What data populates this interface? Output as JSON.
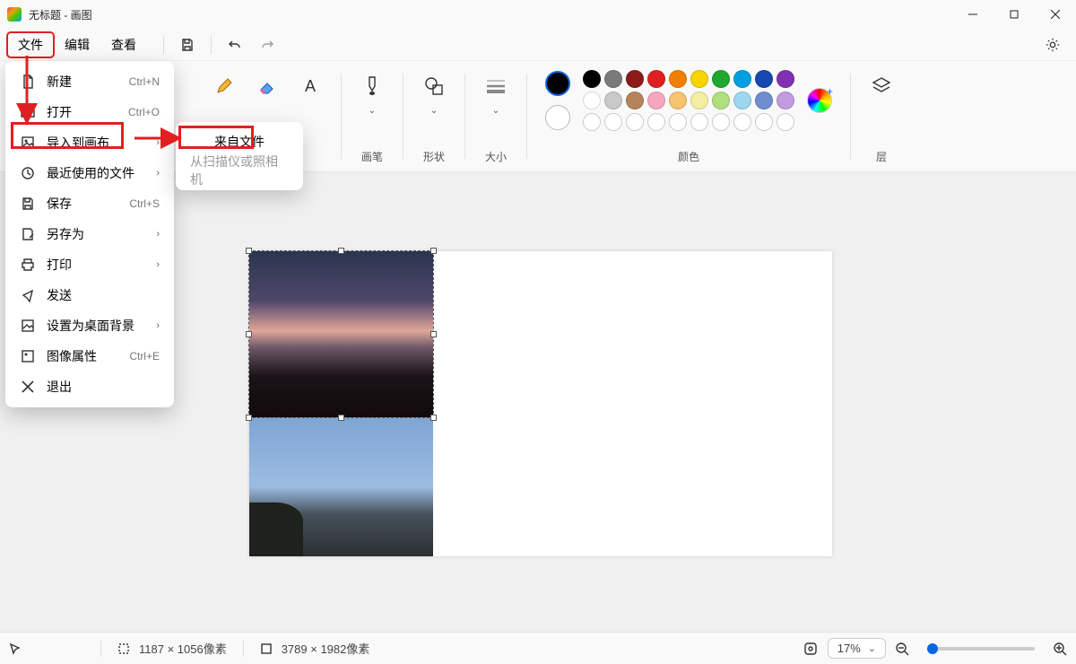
{
  "window": {
    "title": "无标题 - 画图"
  },
  "menubar": {
    "file": "文件",
    "edit": "编辑",
    "view": "查看"
  },
  "ribbon": {
    "brush_group": "画笔",
    "shape_group": "形状",
    "size_group": "大小",
    "color_group": "颜色",
    "layer_group": "层"
  },
  "file_menu": {
    "new": {
      "label": "新建",
      "shortcut": "Ctrl+N"
    },
    "open": {
      "label": "打开",
      "shortcut": "Ctrl+O"
    },
    "import": {
      "label": "导入到画布"
    },
    "recent": {
      "label": "最近使用的文件"
    },
    "save": {
      "label": "保存",
      "shortcut": "Ctrl+S"
    },
    "saveas": {
      "label": "另存为"
    },
    "print": {
      "label": "打印"
    },
    "send": {
      "label": "发送"
    },
    "setbg": {
      "label": "设置为桌面背景"
    },
    "props": {
      "label": "图像属性",
      "shortcut": "Ctrl+E"
    },
    "exit": {
      "label": "退出"
    }
  },
  "submenu": {
    "from_file": "来自文件",
    "from_scanner": "从扫描仪或照相机"
  },
  "palette": {
    "row1": [
      "#000000",
      "#7a7a7a",
      "#8c1a1a",
      "#e02020",
      "#f08000",
      "#f5d400",
      "#1fa82e",
      "#00a0e0",
      "#1648b0",
      "#8030b0"
    ],
    "row2": [
      "#ffffff",
      "#c9c9c9",
      "#b5845a",
      "#f6a7bd",
      "#f7c371",
      "#f4eea3",
      "#b0e07e",
      "#9cd7f0",
      "#6f8dcf",
      "#c39be0"
    ],
    "row3": [
      "#ffffff",
      "#ffffff",
      "#ffffff",
      "#ffffff",
      "#ffffff",
      "#ffffff",
      "#ffffff",
      "#ffffff",
      "#ffffff",
      "#ffffff"
    ]
  },
  "statusbar": {
    "canvas_size": "1187 × 1056像素",
    "image_size": "3789 × 1982像素",
    "zoom": "17%"
  }
}
